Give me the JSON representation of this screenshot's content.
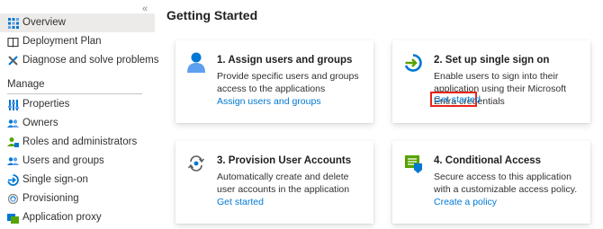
{
  "sidebar": {
    "collapse_glyph": "«",
    "items": [
      {
        "label": "Overview",
        "icon": "overview-grid-icon"
      },
      {
        "label": "Deployment Plan",
        "icon": "book-icon"
      },
      {
        "label": "Diagnose and solve problems",
        "icon": "wrench-icon"
      }
    ],
    "manage_header": "Manage",
    "manage_items": [
      {
        "label": "Properties",
        "icon": "properties-icon"
      },
      {
        "label": "Owners",
        "icon": "owners-icon"
      },
      {
        "label": "Roles and administrators",
        "icon": "roles-icon"
      },
      {
        "label": "Users and groups",
        "icon": "users-groups-icon"
      },
      {
        "label": "Single sign-on",
        "icon": "sso-icon"
      },
      {
        "label": "Provisioning",
        "icon": "provisioning-icon"
      },
      {
        "label": "Application proxy",
        "icon": "app-proxy-icon"
      }
    ],
    "selected": "Overview"
  },
  "main": {
    "title": "Getting Started",
    "cards": [
      {
        "title": "1. Assign users and groups",
        "description": "Provide specific users and groups access to the applications",
        "link": "Assign users and groups",
        "icon": "user-icon"
      },
      {
        "title": "2. Set up single sign on",
        "description": "Enable users to sign into their application using their Microsoft Entra credentials",
        "link": "Get started",
        "icon": "sign-in-icon",
        "highlighted": true
      },
      {
        "title": "3. Provision User Accounts",
        "description": "Automatically create and delete user accounts in the application",
        "link": "Get started",
        "icon": "provision-sync-icon"
      },
      {
        "title": "4. Conditional Access",
        "description": "Secure access to this application with a customizable access policy.",
        "link": "Create a policy",
        "icon": "conditional-access-icon"
      }
    ]
  },
  "colors": {
    "link": "#0078d4",
    "selected_bg": "#edebe9",
    "highlight": "#e8231a",
    "accent_blue": "#0078d4",
    "green": "#57a300"
  }
}
